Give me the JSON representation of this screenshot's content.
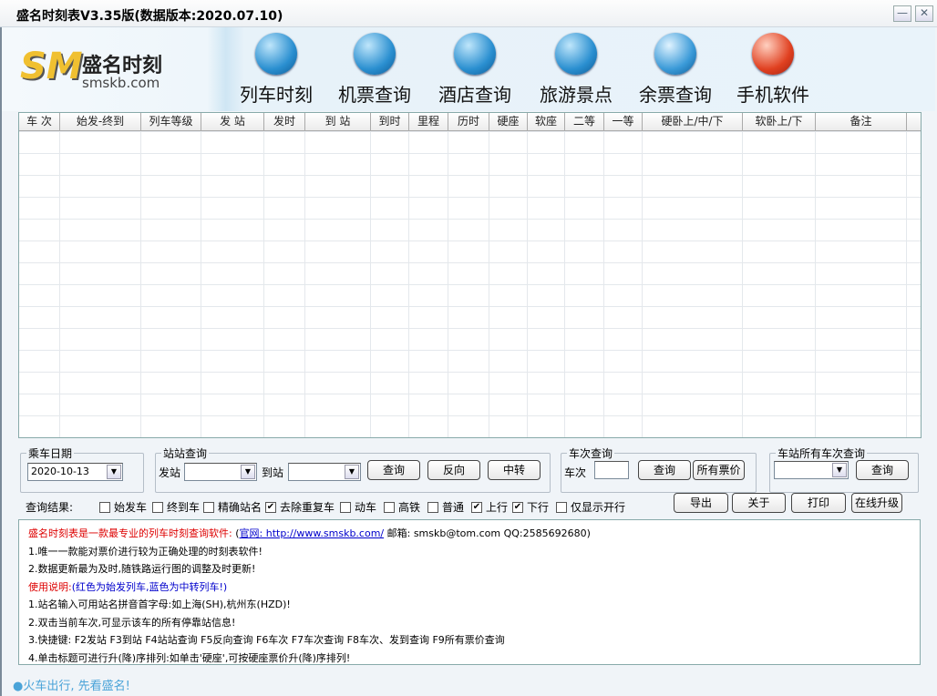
{
  "window": {
    "title": "盛名时刻表V3.35版(数据版本:2020.07.10)",
    "minimize": "—",
    "close": "✕"
  },
  "logo": {
    "mark": "SM",
    "name": "盛名时刻",
    "domain": "smskb.com"
  },
  "nav": [
    {
      "label": "列车时刻",
      "icon": "train-icon"
    },
    {
      "label": "机票查询",
      "icon": "plane-icon"
    },
    {
      "label": "酒店查询",
      "icon": "hotel-icon"
    },
    {
      "label": "旅游景点",
      "icon": "globe-icon"
    },
    {
      "label": "余票查询",
      "icon": "windows-icon"
    },
    {
      "label": "手机软件",
      "icon": "java-icon"
    }
  ],
  "table": {
    "columns": [
      "车 次",
      "始发-终到",
      "列车等级",
      "发  站",
      "发时",
      "到  站",
      "到时",
      "里程",
      "历时",
      "硬座",
      "软座",
      "二等",
      "一等",
      "硬卧上/中/下",
      "软卧上/下",
      "备注"
    ],
    "rows": []
  },
  "date_group": {
    "legend": "乘车日期",
    "value": "2020-10-13"
  },
  "station_group": {
    "legend": "站站查询",
    "from_label": "发站",
    "from_value": "",
    "to_label": "到站",
    "to_value": "",
    "query": "查询",
    "reverse": "反向",
    "transfer": "中转"
  },
  "train_group": {
    "legend": "车次查询",
    "label": "车次",
    "value": "",
    "query": "查询",
    "all_prices": "所有票价"
  },
  "station_all_group": {
    "legend": "车站所有车次查询",
    "value": "",
    "query": "查询"
  },
  "results": {
    "label": "查询结果:",
    "options": [
      {
        "label": "始发车",
        "checked": false
      },
      {
        "label": "终到车",
        "checked": false
      },
      {
        "label": "精确站名",
        "checked": false
      },
      {
        "label": "去除重复车",
        "checked": true
      },
      {
        "label": "动车",
        "checked": false
      },
      {
        "label": "高铁",
        "checked": false
      },
      {
        "label": "普通",
        "checked": false
      },
      {
        "label": "上行",
        "checked": true
      },
      {
        "label": "下行",
        "checked": true
      },
      {
        "label": "仅显示开行",
        "checked": false
      }
    ]
  },
  "actions": {
    "export": "导出",
    "about": "关于",
    "print": "打印",
    "upgrade": "在线升级"
  },
  "info": {
    "headline": "盛名时刻表是一款最专业的列车时刻查询软件:",
    "paren_open": "(",
    "site_label": "官网: http://www.smskb.com/",
    "contact": " 邮箱: smskb@tom.com QQ:2585692680)",
    "line1": "1.唯一一款能对票价进行较为正确处理的时刻表软件!",
    "line2": "2.数据更新最为及时,随铁路运行图的调整及时更新!",
    "usage": "使用说明:",
    "usage_note": "(红色为始发列车,蓝色为中转列车!)",
    "tip1": "1.站名输入可用站名拼音首字母:如上海(SH),杭州东(HZD)!",
    "tip2": "2.双击当前车次,可显示该车的所有停靠站信息!",
    "tip3": "3.快捷键: F2发站 F3到站 F4站站查询 F5反向查询 F6车次 F7车次查询 F8车次、发到查询 F9所有票价查询",
    "tip4": "4.单击标题可进行升(降)序排列:如单击'硬座',可按硬座票价升(降)序排列!"
  },
  "status": "●火车出行, 先看盛名!"
}
